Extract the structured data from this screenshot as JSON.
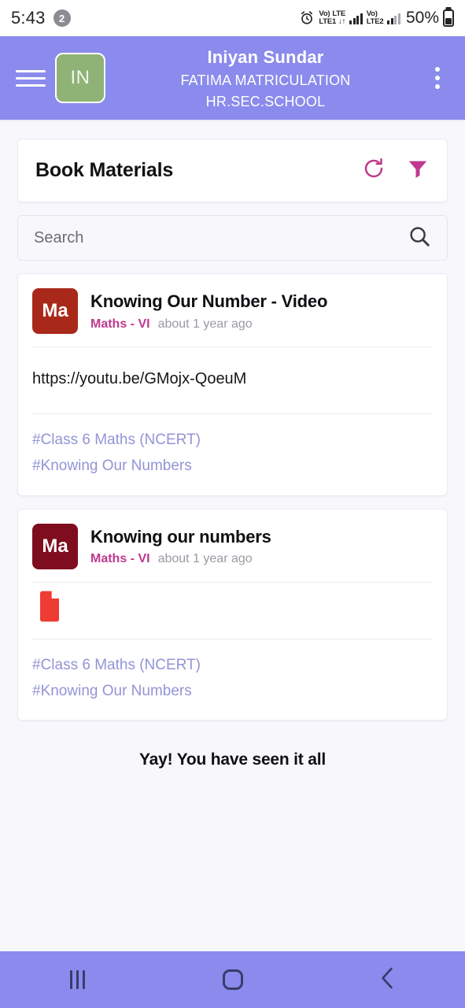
{
  "status_bar": {
    "time": "5:43",
    "notification_count": "2",
    "alarm_icon": "alarm-clock-icon",
    "sim1": {
      "volte": "Vo)",
      "label": "LTE1",
      "network": "LTE",
      "data_arrows": "↓↑"
    },
    "sim2": {
      "volte": "Vo)",
      "label": "LTE2"
    },
    "battery_percent": "50%"
  },
  "app_bar": {
    "menu_icon": "hamburger-menu-icon",
    "avatar_initials": "IN",
    "avatar_color": "#8fb377",
    "user_name": "Iniyan Sundar",
    "school_line1": "FATIMA MATRICULATION",
    "school_line2": "HR.SEC.SCHOOL",
    "overflow_icon": "kebab-menu-icon",
    "background_color": "#8a8bec"
  },
  "panel": {
    "title": "Book Materials",
    "refresh_icon": "refresh-icon",
    "filter_icon": "filter-funnel-icon",
    "accent_color": "#c0398f"
  },
  "search": {
    "placeholder": "Search",
    "value": "",
    "icon": "search-icon"
  },
  "materials": [
    {
      "badge_text": "Ma",
      "badge_color": "#a8291a",
      "title": "Knowing Our Number - Video",
      "subject": "Maths - VI",
      "time_ago": "about 1 year ago",
      "body_type": "link",
      "link": "https://youtu.be/GMojx-QoeuM",
      "tags": [
        "#Class 6 Maths (NCERT)",
        "#Knowing Our Numbers"
      ]
    },
    {
      "badge_text": "Ma",
      "badge_color": "#7e0d1e",
      "title": "Knowing our numbers",
      "subject": "Maths - VI",
      "time_ago": "about 1 year ago",
      "body_type": "file",
      "file_icon": "pdf-file-icon",
      "file_icon_color": "#ee3b33",
      "tags": [
        "#Class 6 Maths (NCERT)",
        "#Knowing Our Numbers"
      ]
    }
  ],
  "end_of_list_message": "Yay! You have seen it all",
  "nav_bar": {
    "recents_icon": "recents-icon",
    "home_icon": "home-icon",
    "back_icon": "back-icon",
    "background_color": "#8a8bec"
  }
}
